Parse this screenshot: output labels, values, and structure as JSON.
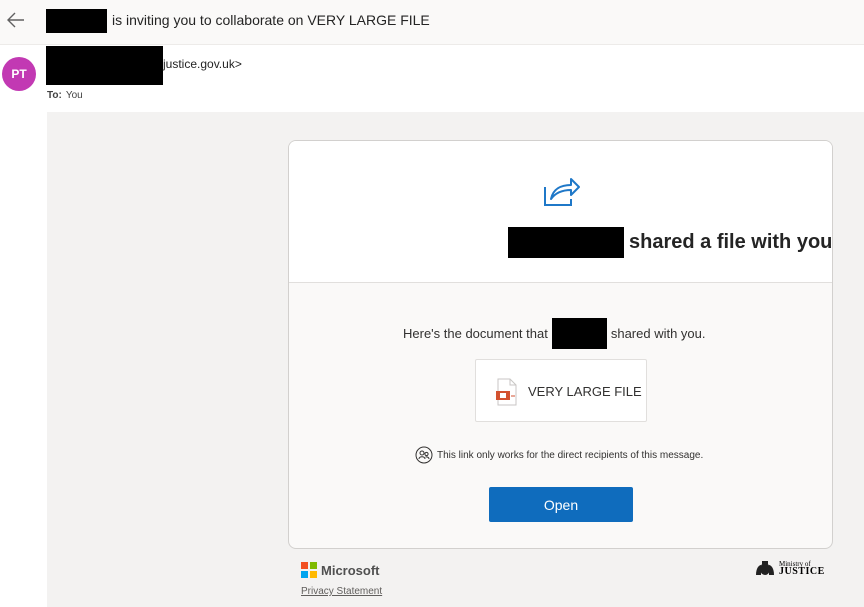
{
  "header": {
    "subject": "is inviting you to collaborate on VERY LARGE FILE",
    "back_icon": "back-arrow-icon"
  },
  "sender": {
    "initials": "PT",
    "avatar_color": "#c239b3",
    "domain_suffix": "justice.gov.uk>",
    "to_label": "To:",
    "to_value": "You"
  },
  "card": {
    "share_icon": "share-arrow-icon",
    "shared_text": "shared a file with you",
    "doc_line_prefix": "Here's the document that",
    "doc_line_suffix": "shared with you.",
    "file_name": "VERY LARGE FILE",
    "file_icon": "powerpoint-file-icon",
    "link_note": "This link only works for the direct recipients of this message.",
    "open_label": "Open",
    "accent": "#0f6cbd"
  },
  "footer": {
    "microsoft_label": "Microsoft",
    "privacy_label": "Privacy Statement",
    "moj_line1": "Ministry of",
    "moj_line2": "JUSTICE"
  }
}
